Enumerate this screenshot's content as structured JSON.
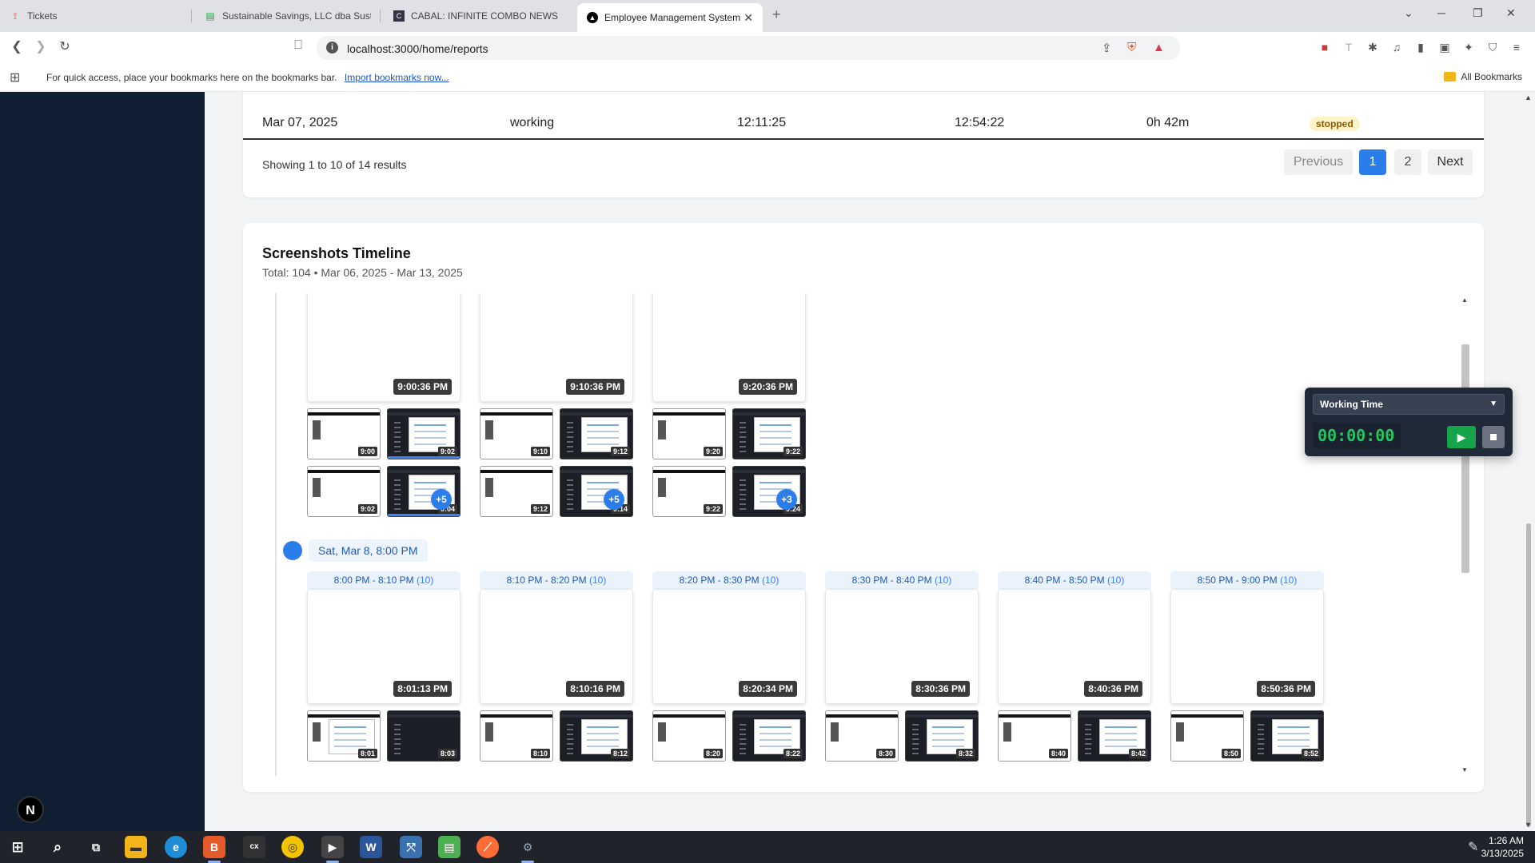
{
  "browser": {
    "tabs": [
      {
        "title": "Tickets",
        "icon": "zammad-icon",
        "color": "#e14b4b"
      },
      {
        "title": "Sustainable Savings, LLC dba Sustain",
        "icon": "receipt-icon",
        "color": "#25a244"
      },
      {
        "title": "CABAL: INFINITE COMBO NEWS",
        "icon": "cabal-icon",
        "color": "#334"
      },
      {
        "title": "Employee Management System",
        "icon": "nextjs-icon",
        "color": "#000",
        "active": true
      }
    ],
    "new_tab": "+",
    "url": "localhost:3000/home/reports",
    "bookmarks_hint": "For quick access, place your bookmarks here on the bookmarks bar.",
    "import_link": "Import bookmarks now...",
    "all_bookmarks": "All Bookmarks"
  },
  "sessions": {
    "last_row": {
      "date": "Mar 07, 2025",
      "activity": "working",
      "start": "12:11:25",
      "end": "12:54:22",
      "duration": "0h 42m",
      "status": "stopped"
    },
    "showing": "Showing 1 to 10 of 14 results",
    "pagination": {
      "previous": "Previous",
      "page1": "1",
      "page2": "2",
      "next": "Next"
    }
  },
  "timeline": {
    "title": "Screenshots Timeline",
    "subtitle": "Total: 104 • Mar 06, 2025 - Mar 13, 2025",
    "upper_groups": [
      {
        "time": "9:00:36 PM",
        "minis": [
          "9:00",
          "9:02",
          "9:02",
          "9:04"
        ],
        "more": "+5"
      },
      {
        "time": "9:10:36 PM",
        "minis": [
          "9:10",
          "9:12",
          "9:12",
          "9:14"
        ],
        "more": "+5"
      },
      {
        "time": "9:20:36 PM",
        "minis": [
          "9:20",
          "9:22",
          "9:22",
          "9:24"
        ],
        "more": "+3"
      }
    ],
    "day_label": "Sat, Mar 8, 8:00 PM",
    "lower_groups": [
      {
        "range": "8:00 PM - 8:10 PM",
        "count": "(10)",
        "time": "8:01:13 PM",
        "minis": [
          "8:01",
          "8:03"
        ]
      },
      {
        "range": "8:10 PM - 8:20 PM",
        "count": "(10)",
        "time": "8:10:16 PM",
        "minis": [
          "8:10",
          "8:12"
        ]
      },
      {
        "range": "8:20 PM - 8:30 PM",
        "count": "(10)",
        "time": "8:20:34 PM",
        "minis": [
          "8:20",
          "8:22"
        ]
      },
      {
        "range": "8:30 PM - 8:40 PM",
        "count": "(10)",
        "time": "8:30:36 PM",
        "minis": [
          "8:30",
          "8:32"
        ]
      },
      {
        "range": "8:40 PM - 8:50 PM",
        "count": "(10)",
        "time": "8:40:36 PM",
        "minis": [
          "8:40",
          "8:42"
        ]
      },
      {
        "range": "8:50 PM - 9:00 PM",
        "count": "(10)",
        "time": "8:50:36 PM",
        "minis": [
          "8:50",
          "8:52"
        ]
      }
    ]
  },
  "timer": {
    "mode": "Working Time",
    "clock": "00:00:00"
  },
  "taskbar": {
    "time": "1:26 AM",
    "date": "3/13/2025"
  },
  "dev_badge": "N",
  "colors": {
    "sidebar": "#0f1e33",
    "accent": "#2b7de9",
    "status_stopped_bg": "#fef3c7",
    "timer_green": "#22c55e"
  }
}
